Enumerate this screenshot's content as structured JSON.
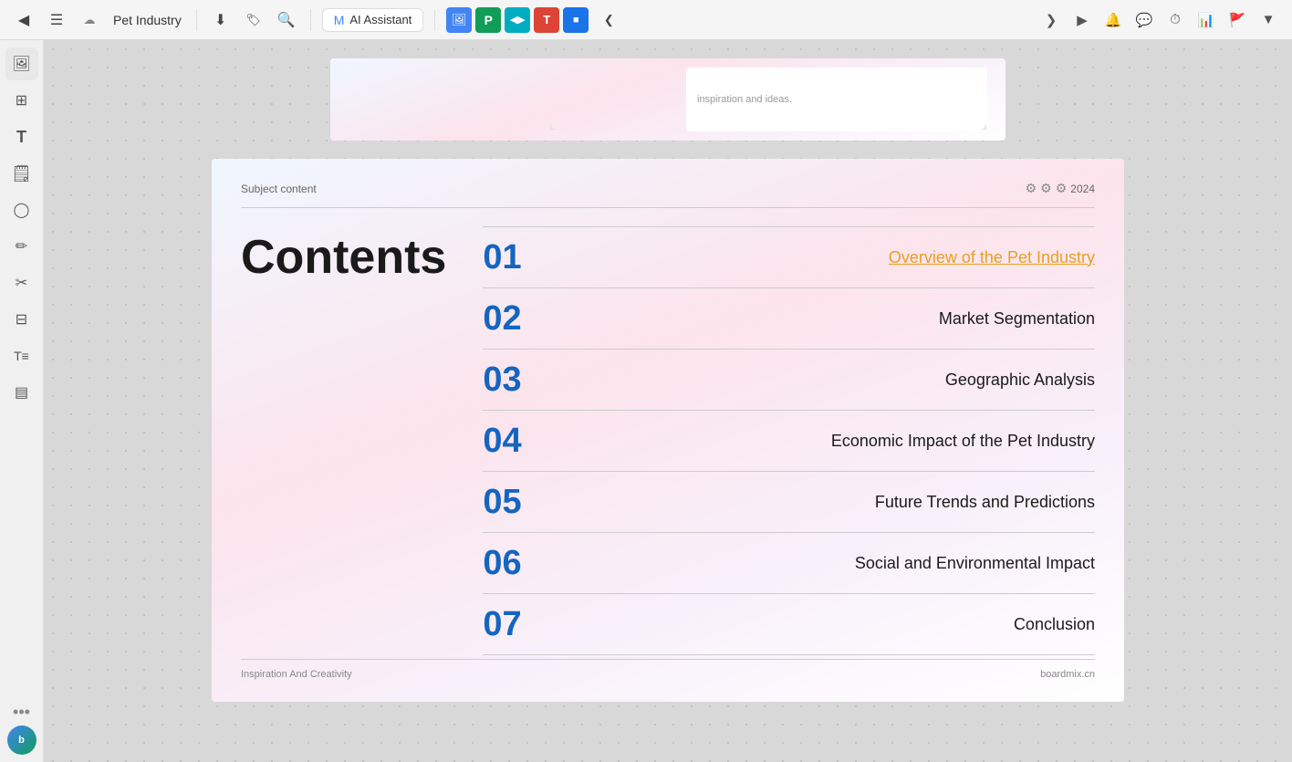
{
  "toolbar": {
    "back_icon": "◀",
    "menu_icon": "☰",
    "cloud_icon": "☁",
    "title": "Pet Industry",
    "download_icon": "⬇",
    "tag_icon": "🏷",
    "search_icon": "🔍",
    "ai_label": "AI Assistant",
    "ai_icon": "M",
    "tab_icons": [
      {
        "label": "🖼",
        "class": "tab-icon-blue",
        "name": "tab-icon-1"
      },
      {
        "label": "P",
        "class": "tab-icon-green",
        "name": "tab-icon-2"
      },
      {
        "label": "◀▶",
        "class": "tab-icon-cyan",
        "name": "tab-icon-3"
      },
      {
        "label": "T",
        "class": "tab-icon-red",
        "name": "tab-icon-4"
      },
      {
        "label": "◼",
        "class": "tab-icon-blue2",
        "name": "tab-icon-5"
      }
    ],
    "collapse_icon": "❮",
    "right_icons": [
      "⊞",
      "▶",
      "🔔",
      "💬",
      "⏱",
      "📊",
      "🚩",
      "▼"
    ]
  },
  "sidebar": {
    "icons": [
      {
        "symbol": "🖼",
        "name": "gallery-icon"
      },
      {
        "symbol": "⊞",
        "name": "grid-icon"
      },
      {
        "symbol": "T",
        "name": "text-icon"
      },
      {
        "symbol": "🗒",
        "name": "sticky-note-icon"
      },
      {
        "symbol": "◯",
        "name": "shape-icon"
      },
      {
        "symbol": "✏",
        "name": "pen-icon"
      },
      {
        "symbol": "✂",
        "name": "scissors-icon"
      },
      {
        "symbol": "⊟",
        "name": "table-icon"
      },
      {
        "symbol": "T≡",
        "name": "text-list-icon"
      },
      {
        "symbol": "▤",
        "name": "layout-icon"
      }
    ],
    "bottom": {
      "dots": "•••",
      "avatar_initials": "b"
    }
  },
  "preview_card": {
    "text": "inspiration and ideas."
  },
  "slide": {
    "subject": "Subject content",
    "year_icons": "⚙⚙⚙",
    "year": "2024",
    "contents_title": "Contents",
    "items": [
      {
        "number": "01",
        "label": "Overview of the Pet Industry",
        "active": true
      },
      {
        "number": "02",
        "label": "Market Segmentation",
        "active": false
      },
      {
        "number": "03",
        "label": "Geographic Analysis",
        "active": false
      },
      {
        "number": "04",
        "label": "Economic Impact of the Pet Industry",
        "active": false
      },
      {
        "number": "05",
        "label": "Future Trends and Predictions",
        "active": false
      },
      {
        "number": "06",
        "label": "Social and Environmental Impact",
        "active": false
      },
      {
        "number": "07",
        "label": "Conclusion",
        "active": false
      }
    ],
    "footer_left": "Inspiration And Creativity",
    "footer_right": "boardmix.cn"
  }
}
